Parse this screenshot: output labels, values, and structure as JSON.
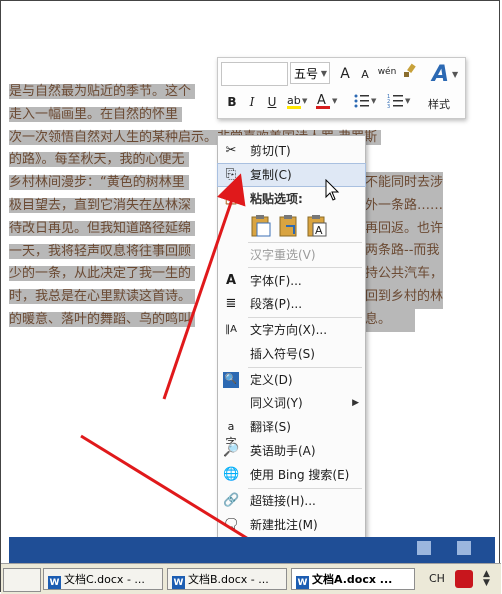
{
  "document": {
    "lines": [
      "是与自然最为贴近的季节。这个",
      "走入一幅画里。在自然的怀里",
      "次一次领悟自然对人生的某种启示。非常喜欢美国诗人罗·弗罗斯",
      "的路》。每至秋天，我的心便无",
      "乡村林间漫步：“黄色的树林里",
      "极目望去，直到它消失在丛林深",
      "待改日再见。但我知道路径延绵",
      "一天，我将轻声叹息将往事回顾",
      "少的一条，从此决定了我一生的",
      "时，我总是在心里默读这首诗。",
      "的暖意、落叶的舞蹈、鸟的鸣叫"
    ],
    "right_fragments": [
      "",
      "",
      "",
      "",
      "不能同时去涉",
      "外一条路……",
      "再回返。也许",
      "两条路--而我",
      "持公共汽车，",
      "回到乡村的林",
      "息。"
    ]
  },
  "mini_toolbar": {
    "font_size": "五号",
    "style_label": "样式",
    "grow_font": "A",
    "shrink_font": "A",
    "phonetic": "wén",
    "bold": "B",
    "italic": "I",
    "underline": "U",
    "font_color_glyph": "A",
    "style_glyph": "A"
  },
  "context_menu": {
    "cut": "剪切(T)",
    "copy": "复制(C)",
    "paste_options": "粘贴选项:",
    "reconvert": "汉字重选(V)",
    "font": "字体(F)...",
    "paragraph": "段落(P)...",
    "text_direction": "文字方向(X)...",
    "insert_symbol": "插入符号(S)",
    "define": "定义(D)",
    "synonyms": "同义词(Y)",
    "translate": "翻译(S)",
    "english_assistant": "英语助手(A)",
    "bing_search": "使用 Bing 搜索(E)",
    "hyperlink": "超链接(H)...",
    "new_comment": "新建批注(M)"
  },
  "taskbar": {
    "tasks": [
      {
        "label": "文档C.docx - ..."
      },
      {
        "label": "文档B.docx - ..."
      },
      {
        "label": "文档A.docx ..."
      }
    ],
    "ime": "CH",
    "icon_letter": "W"
  },
  "colors": {
    "highlight": "#b8b8b8",
    "arrow": "#e0191b",
    "taskbar_blue": "#1f4e96",
    "menu_highlight": "#dfe8f5"
  }
}
